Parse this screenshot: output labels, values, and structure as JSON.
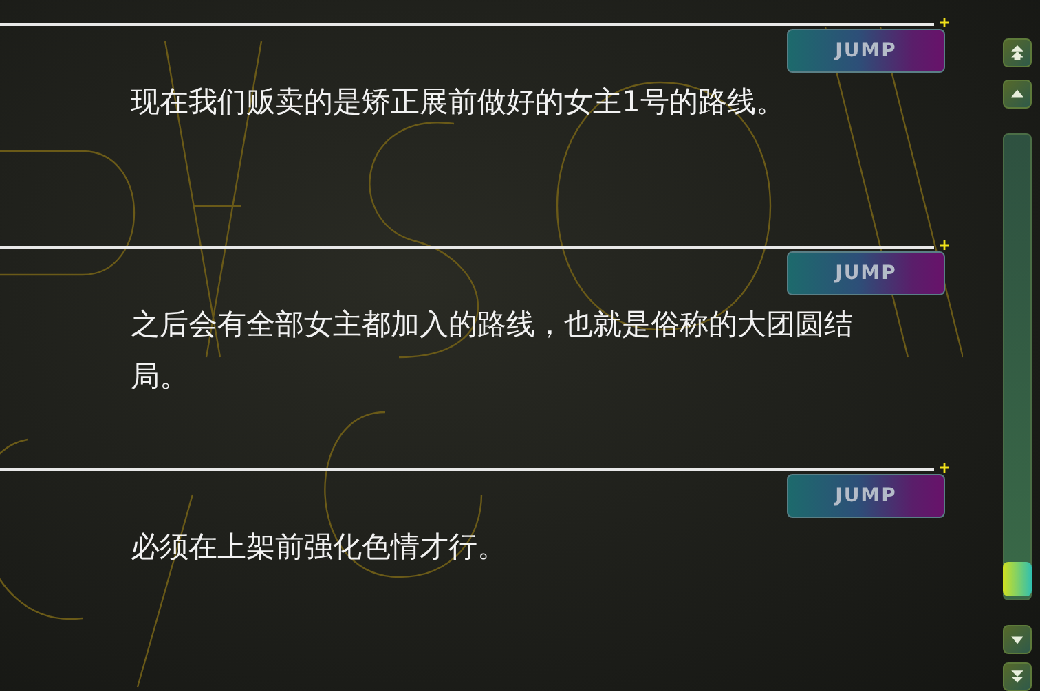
{
  "entries": [
    {
      "text": "现在我们贩卖的是矫正展前做好的女主1号的路线。",
      "jump_label": "JUMP"
    },
    {
      "text": "之后会有全部女主都加入的路线，也就是俗称的大团圆结局。",
      "jump_label": "JUMP"
    },
    {
      "text": "必须在上架前强化色情才行。",
      "jump_label": "JUMP"
    }
  ]
}
